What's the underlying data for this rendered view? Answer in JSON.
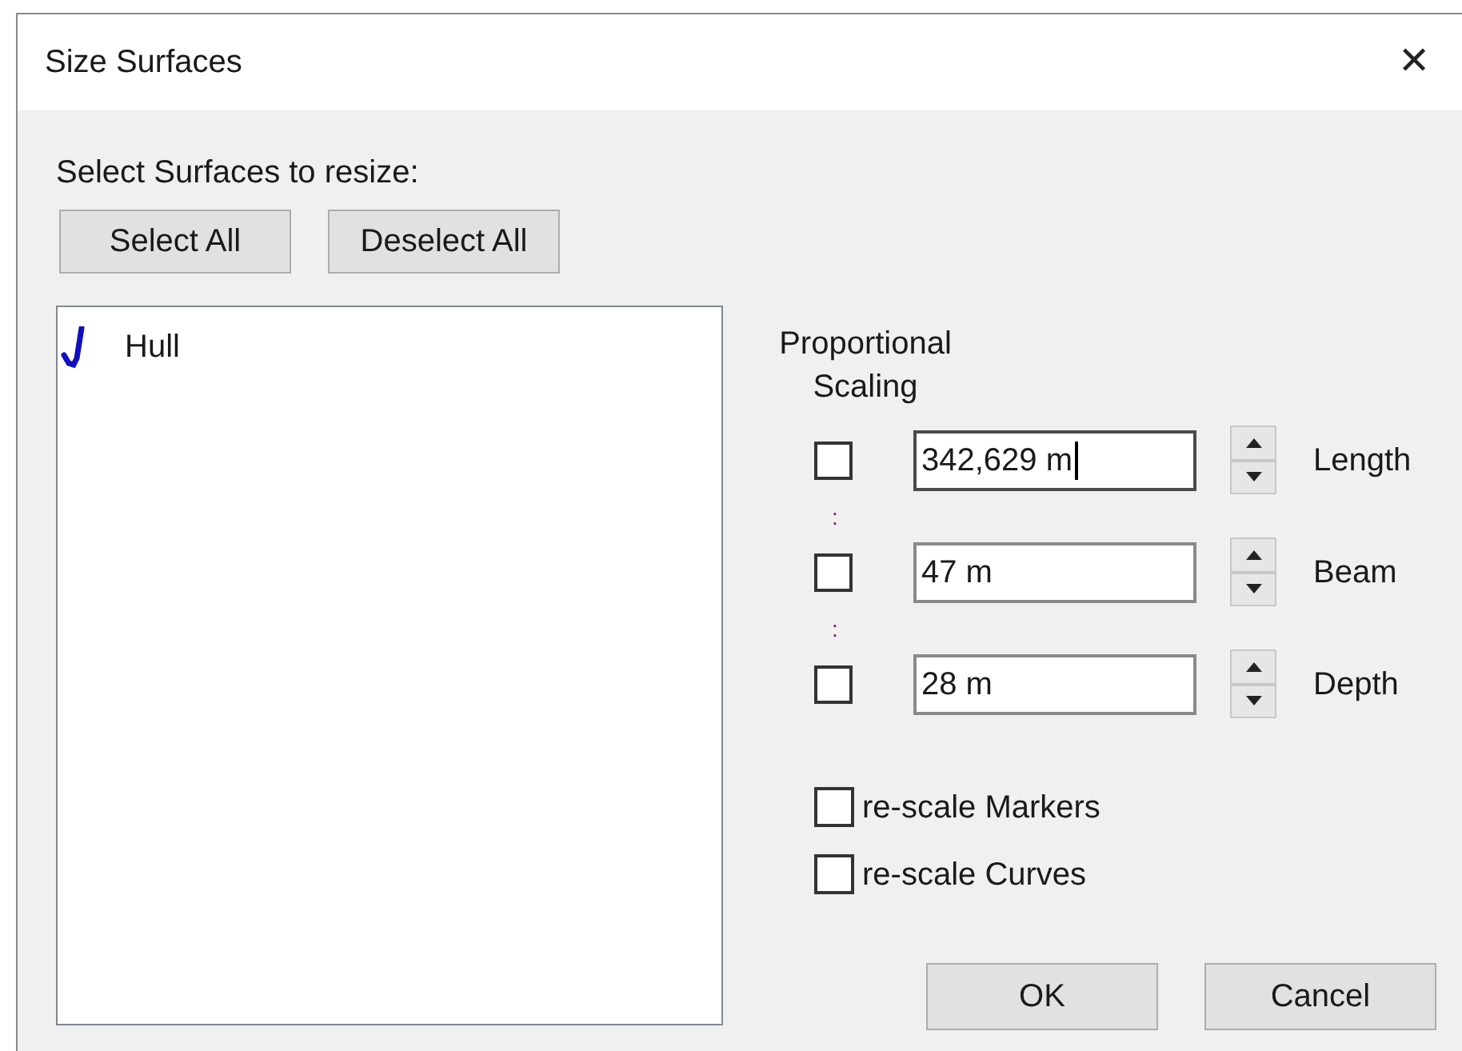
{
  "window": {
    "title": "Size Surfaces",
    "close": "✕"
  },
  "surfaces": {
    "label": "Select Surfaces to resize:",
    "buttons": [
      "Select All",
      "Deselect All"
    ],
    "items": [
      {
        "label": "Hull",
        "checked": true
      }
    ]
  },
  "scaling": {
    "label": "Proportional Scaling",
    "rows": [
      {
        "checked": false,
        "value": "342,629 m",
        "focused": true,
        "label": "Length"
      },
      {
        "checked": false,
        "value": "47 m",
        "focused": false,
        "label": "Beam"
      },
      {
        "checked": false,
        "value": "28 m",
        "focused": false,
        "label": "Depth"
      }
    ],
    "links": [
      ":",
      ":"
    ]
  },
  "options": [
    {
      "label": "re-scale Markers",
      "checked": false
    },
    {
      "label": "re-scale Curves",
      "checked": false
    }
  ],
  "buttons": [
    "OK",
    "Cancel"
  ]
}
